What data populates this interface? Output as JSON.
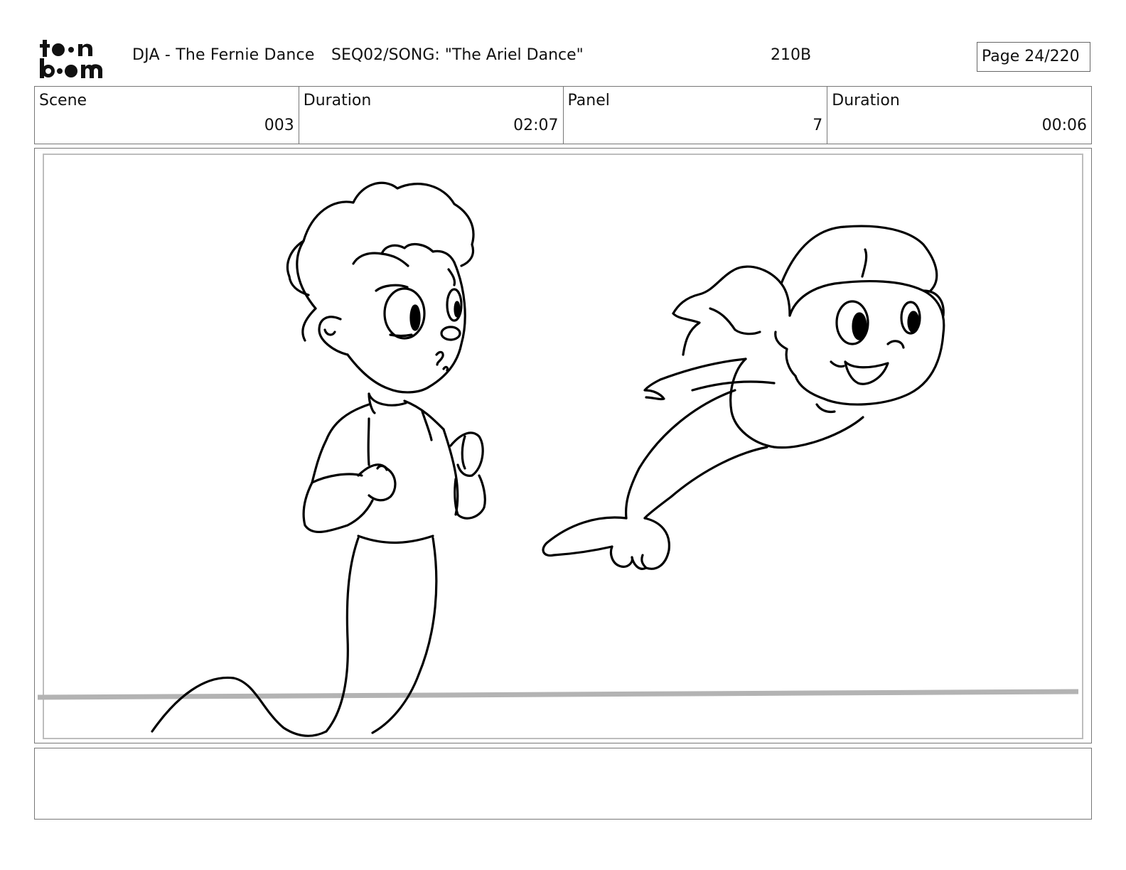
{
  "header": {
    "logo_text_top": "toon",
    "logo_text_bottom": "boom",
    "project_title": "DJA - The Fernie Dance",
    "sequence_title": "SEQ02/SONG: \"The Ariel Dance\"",
    "panel_code": "210B",
    "page_label": "Page  24/220"
  },
  "info_bar": {
    "scene_label": "Scene",
    "scene_value": "003",
    "scene_duration_label": "Duration",
    "scene_duration_value": "02:07",
    "panel_label": "Panel",
    "panel_value": "7",
    "panel_duration_label": "Duration",
    "panel_duration_value": "00:06"
  },
  "drawing": {
    "subjects": [
      "merboy-character",
      "mermaid-character"
    ],
    "line_color": "#000000",
    "ground_line_color": "#b3b3b3"
  },
  "notes": {
    "text": ""
  }
}
